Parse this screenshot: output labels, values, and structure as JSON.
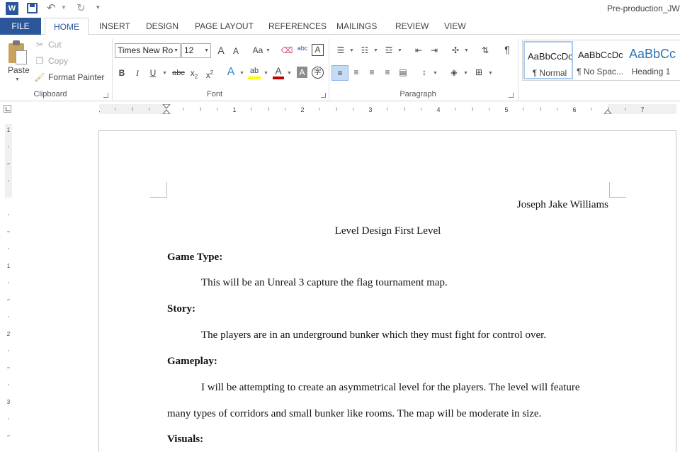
{
  "titlebar": {
    "app_icon": "W",
    "doc_title": "Pre-production_JWi"
  },
  "tabs": [
    "FILE",
    "HOME",
    "INSERT",
    "DESIGN",
    "PAGE LAYOUT",
    "REFERENCES",
    "MAILINGS",
    "REVIEW",
    "VIEW"
  ],
  "clipboard": {
    "paste": "Paste",
    "cut": "Cut",
    "copy": "Copy",
    "format_painter": "Format Painter",
    "label": "Clipboard"
  },
  "font": {
    "family": "Times New Ro",
    "size": "12",
    "grow": "A",
    "shrink": "A",
    "case": "Aa",
    "bold": "B",
    "italic": "I",
    "underline": "U",
    "strike": "abc",
    "subscript": "x",
    "subscript_mark": "2",
    "superscript": "x",
    "superscript_mark": "2",
    "label": "Font"
  },
  "paragraph": {
    "label": "Paragraph",
    "pilcrow": "¶"
  },
  "styles": [
    {
      "preview": "AaBbCcDc",
      "name": "¶ Normal",
      "selected": true
    },
    {
      "preview": "AaBbCcDc",
      "name": "¶ No Spac...",
      "selected": false
    },
    {
      "preview": "AaBbCc",
      "name": "Heading 1",
      "selected": false
    }
  ],
  "ruler": {
    "numbers": [
      "1",
      "1",
      "2",
      "3",
      "4",
      "5",
      "6",
      "7"
    ],
    "vertical_numbers": [
      "1",
      "1",
      "2",
      "3"
    ]
  },
  "document": {
    "author": "Joseph Jake Williams",
    "title": "Level Design First Level",
    "game_type_heading": "Game Type:",
    "game_type_text": "This will be an Unreal 3 capture the flag tournament map.",
    "story_heading": "Story:",
    "story_text": "The players are in an underground bunker which they must fight for control over.",
    "gameplay_heading": "Gameplay:",
    "gameplay_text_1": "I will be attempting to create an asymmetrical level for the players. The level will feature",
    "gameplay_text_2": "many types of corridors and small bunker like rooms. The map will be moderate in size.",
    "visuals_heading": "Visuals:"
  },
  "colors": {
    "accent": "#2b579a",
    "highlight": "#ffff00",
    "font_color": "#c00000"
  }
}
